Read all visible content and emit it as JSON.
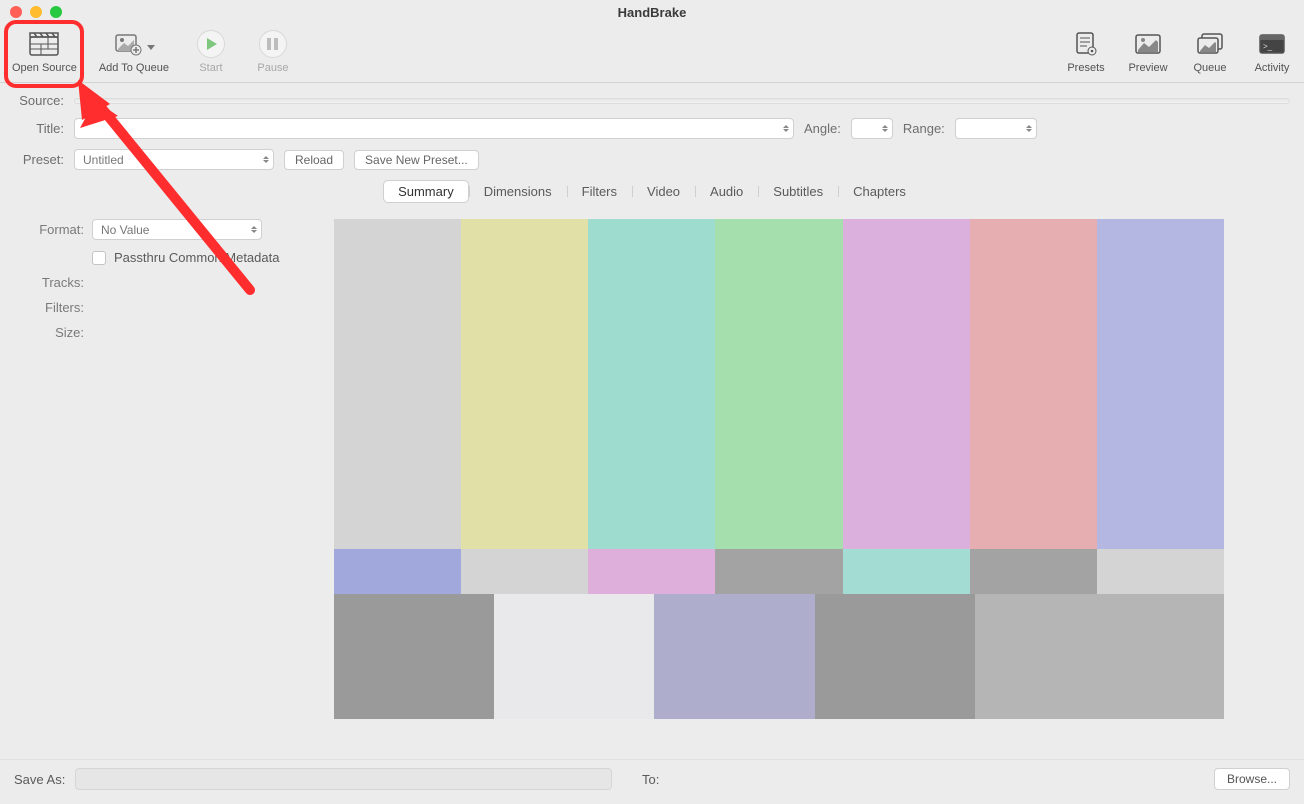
{
  "window": {
    "title": "HandBrake"
  },
  "toolbar": {
    "open_source": "Open Source",
    "add_to_queue": "Add To Queue",
    "start": "Start",
    "pause": "Pause",
    "presets": "Presets",
    "preview": "Preview",
    "queue": "Queue",
    "activity": "Activity"
  },
  "labels": {
    "source": "Source:",
    "title": "Title:",
    "angle": "Angle:",
    "range": "Range:",
    "preset": "Preset:",
    "format": "Format:",
    "tracks": "Tracks:",
    "filters": "Filters:",
    "size": "Size:",
    "save_as": "Save As:",
    "to": "To:"
  },
  "preset": {
    "selected": "Untitled",
    "reload": "Reload",
    "save_new": "Save New Preset..."
  },
  "tabs": {
    "summary": "Summary",
    "dimensions": "Dimensions",
    "filters": "Filters",
    "video": "Video",
    "audio": "Audio",
    "subtitles": "Subtitles",
    "chapters": "Chapters"
  },
  "summary": {
    "format_value": "No Value",
    "passthru": "Passthru Common Metadata"
  },
  "buttons": {
    "browse": "Browse..."
  },
  "colors": {
    "top": [
      "#d4d4d4",
      "#e1e0a6",
      "#9fdcd0",
      "#a5dfad",
      "#dcb0dc",
      "#e7aeb1",
      "#b3b7e1"
    ],
    "mid": [
      "#a1a8db",
      "#d4d4d4",
      "#dfafdb",
      "#a3a3a3",
      "#a3dcd2",
      "#a3a3a3",
      "#d4d4d4"
    ],
    "bot": [
      "#9a9a9a",
      "#e9e8ea",
      "#aeadcb",
      "#9a9a9a",
      "#b5b5b5"
    ]
  }
}
